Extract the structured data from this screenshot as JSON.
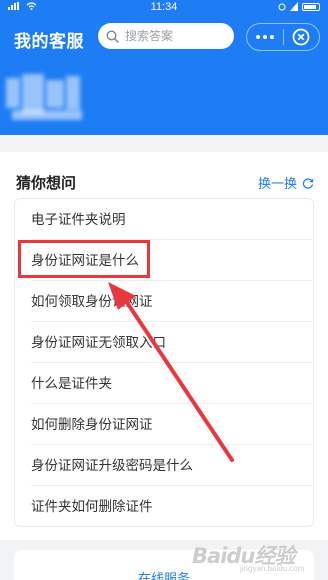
{
  "status": {
    "time": "11:34"
  },
  "header": {
    "title": "我的客服",
    "search_placeholder": "搜索答案"
  },
  "faq": {
    "title": "猜你想问",
    "refresh_label": "换一换",
    "items": [
      "电子证件夹说明",
      "身份证网证是什么",
      "如何领取身份证网证",
      "身份证网证无领取入口",
      "什么是证件夹",
      "如何删除身份证网证",
      "身份证网证升级密码是什么",
      "证件夹如何删除证件"
    ],
    "highlighted_index": 1
  },
  "bottom": {
    "link_label": "在线服务"
  },
  "watermark": {
    "main": "Baidu经验",
    "sub": "jingyan.baidu.com"
  },
  "colors": {
    "brand": "#1e7cf5",
    "annotation": "#e8383d"
  }
}
